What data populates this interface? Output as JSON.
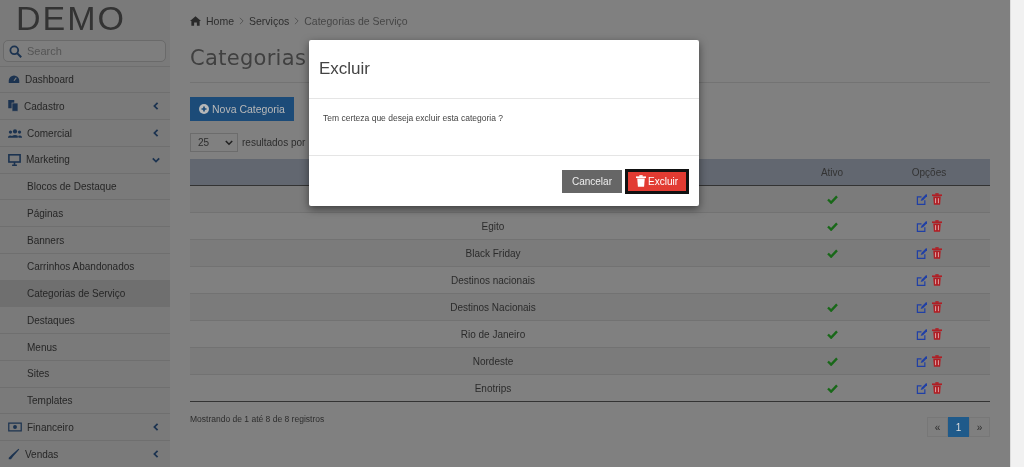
{
  "logo": {
    "text": "DEMO"
  },
  "sidebar": {
    "search": {
      "placeholder": "Search"
    },
    "items": [
      {
        "label": "Dashboard"
      },
      {
        "label": "Cadastro",
        "expanded": false
      },
      {
        "label": "Comercial",
        "expanded": false
      },
      {
        "label": "Marketing",
        "expanded": true,
        "children": [
          {
            "label": "Blocos de Destaque",
            "selected": false
          },
          {
            "label": "Páginas",
            "selected": false
          },
          {
            "label": "Banners",
            "selected": false
          },
          {
            "label": "Carrinhos Abandonados",
            "selected": false
          },
          {
            "label": "Categorias de Serviço",
            "selected": true
          },
          {
            "label": "Destaques",
            "selected": false
          },
          {
            "label": "Menus",
            "selected": false
          },
          {
            "label": "Sites",
            "selected": false
          },
          {
            "label": "Templates",
            "selected": false
          }
        ]
      },
      {
        "label": "Financeiro",
        "expanded": false
      },
      {
        "label": "Vendas",
        "expanded": false
      }
    ]
  },
  "breadcrumb": [
    "Home",
    "Serviços",
    "Categorias de Serviço"
  ],
  "page_title": "Categorias",
  "new_button": "Nova Categoria",
  "page_length": {
    "value": "25",
    "label": "resultados por"
  },
  "table": {
    "columns": [
      "Ativo",
      "Opções"
    ],
    "rows": [
      {
        "active": true
      },
      {
        "name": "Egito",
        "active": true
      },
      {
        "name": "Black Friday",
        "active": true
      },
      {
        "name": "Destinos nacionais",
        "active": false
      },
      {
        "name": "Destinos Nacionais",
        "active": true
      },
      {
        "name": "Rio de Janeiro",
        "active": true
      },
      {
        "name": "Nordeste",
        "active": true
      },
      {
        "name": "Enotrips",
        "active": true
      }
    ]
  },
  "table_info": "Mostrando de 1 até 8 de 8 registros",
  "pagination": [
    {
      "label": "«",
      "selected": false
    },
    {
      "label": "1",
      "selected": true
    },
    {
      "label": "»",
      "selected": false
    }
  ],
  "modal": {
    "title": "Excluir",
    "message": "Tem certeza que deseja excluir esta categoria ?",
    "buttons": [
      {
        "label": "Cancelar",
        "kind": "secondary",
        "focused": false
      },
      {
        "label": "Excluir",
        "kind": "danger",
        "focused": true
      }
    ]
  }
}
